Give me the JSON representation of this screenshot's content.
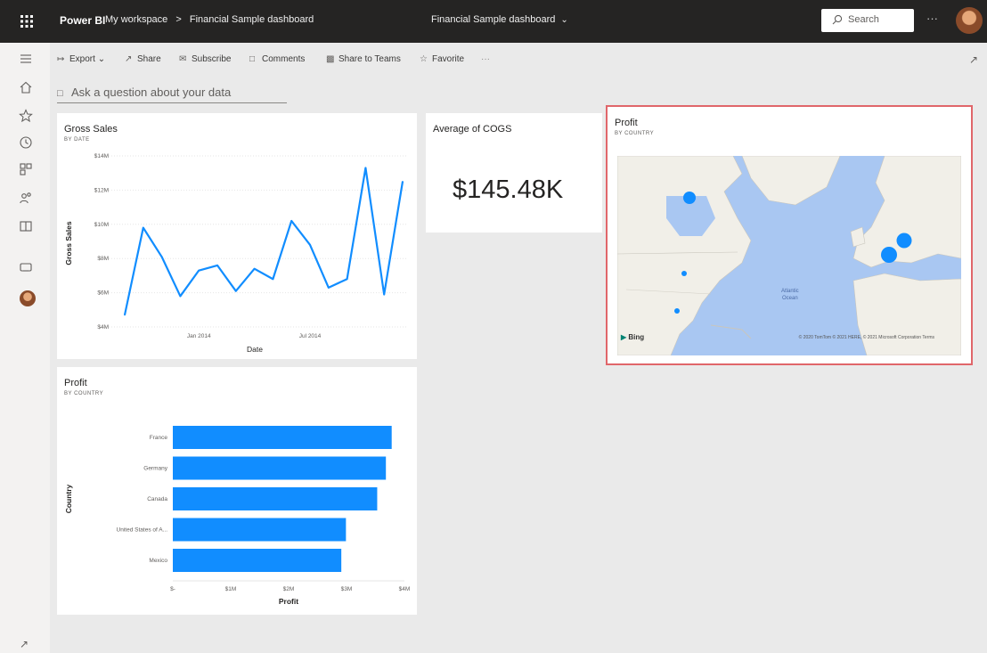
{
  "topbar": {
    "brand": "Power BI",
    "breadcrumb": [
      "My workspace",
      ">",
      "Financial Sample dashboard"
    ],
    "title": "Financial Sample dashboard",
    "search_placeholder": "Search",
    "more": "···"
  },
  "toolbar": {
    "export": "Export",
    "share": "Share",
    "subscribe": "Subscribe",
    "comments": "Comments",
    "share_teams": "Share to Teams",
    "favorite": "Favorite",
    "more": "···"
  },
  "qna": {
    "placeholder": "Ask a question about your data"
  },
  "tiles": {
    "gross_sales": {
      "title": "Gross Sales",
      "subtitle": "BY DATE"
    },
    "cogs": {
      "title": "Average of COGS",
      "value": "$145.48K"
    },
    "map": {
      "title": "Profit",
      "subtitle": "BY COUNTRY",
      "provider": "Bing",
      "ocean_label_1": "Atlantic",
      "ocean_label_2": "Ocean",
      "copyright": "© 2020 TomTom © 2021 HERE, © 2021 Microsoft Corporation  Terms"
    },
    "profit_bar": {
      "title": "Profit",
      "subtitle": "BY COUNTRY"
    }
  },
  "chart_data": [
    {
      "type": "line",
      "title": "Gross Sales",
      "subtitle": "BY DATE",
      "xlabel": "Date",
      "ylabel": "Gross Sales",
      "x_tick_labels": [
        "Jan 2014",
        "Jul 2014"
      ],
      "y_tick_labels": [
        "$4M",
        "$6M",
        "$8M",
        "$10M",
        "$12M",
        "$14M"
      ],
      "ylim": [
        4,
        14
      ],
      "y_unit": "M",
      "x": [
        "2013-09",
        "2013-10",
        "2013-11",
        "2013-12",
        "2014-01",
        "2014-02",
        "2014-03",
        "2014-04",
        "2014-05",
        "2014-06",
        "2014-07",
        "2014-08",
        "2014-09",
        "2014-10",
        "2014-11",
        "2014-12"
      ],
      "values": [
        4.7,
        9.8,
        8.1,
        5.8,
        7.3,
        7.6,
        6.1,
        7.4,
        6.8,
        10.2,
        8.8,
        6.3,
        6.8,
        13.3,
        5.9,
        12.5
      ],
      "color": "#118dff",
      "grid": true
    },
    {
      "type": "bar",
      "orientation": "horizontal",
      "title": "Profit",
      "subtitle": "BY COUNTRY",
      "xlabel": "Profit",
      "ylabel": "Country",
      "categories": [
        "France",
        "Germany",
        "Canada",
        "United States of A...",
        "Mexico"
      ],
      "values": [
        3.78,
        3.68,
        3.53,
        2.99,
        2.91
      ],
      "value_unit": "M",
      "x_tick_labels": [
        "$-",
        "$1M",
        "$2M",
        "$3M",
        "$4M"
      ],
      "xlim": [
        0,
        4
      ],
      "color": "#118dff"
    }
  ],
  "map_points": [
    {
      "location": "Canada",
      "size": "medium"
    },
    {
      "location": "United States",
      "size": "small"
    },
    {
      "location": "Mexico",
      "size": "small"
    },
    {
      "location": "Germany",
      "size": "large"
    },
    {
      "location": "France",
      "size": "large"
    }
  ],
  "colors": {
    "accent": "#118dff",
    "topbar": "#252423",
    "highlight_border": "#e0666a"
  }
}
